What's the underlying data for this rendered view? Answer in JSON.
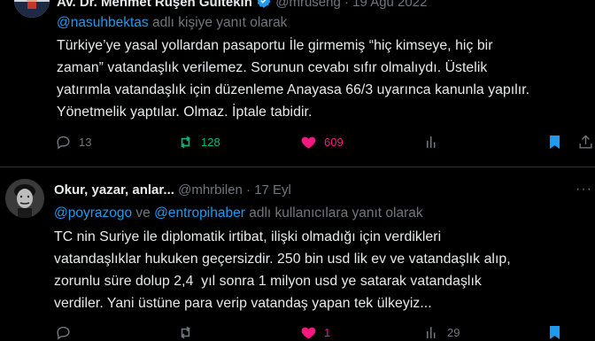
{
  "tweet1": {
    "author_name": "Av. Dr. Mehmet Ruşen Gültekin",
    "handle": "@mruseng",
    "date": "19 Ağu 2022",
    "reply_prefix": "",
    "reply_mentions": [
      "@nasuhbektas"
    ],
    "reply_suffix": " adlı kişiye yanıt olarak",
    "body_lines": [
      "Türkiye’ye yasal yollardan pasaportu İle girmemiş “hiç kimseye, hiç bir",
      "zaman” vatandaşlık verilemez. Sorunun cevabı sıfır olmalıydı. Üstelik",
      "yatırımla vatandaşlık için düzenleme Anayasa 66/3 uyarınca kanunla yapılır.",
      "Yönetmelik yaptılar. Olmaz. İptale tabidir."
    ],
    "replies": "13",
    "retweets": "128",
    "likes": "609"
  },
  "tweet2": {
    "author_name": "Okur, yazar, anlar...",
    "handle": "@mhrbilen",
    "date": "17 Eyl",
    "reply_mentions": [
      "@poyrazogo",
      "@entropihaber"
    ],
    "reply_joiner": " ve ",
    "reply_suffix": " adlı kullanıcılara yanıt olarak",
    "body_lines": [
      "TC nin Suriye ile diplomatik irtibat, ilişki olmadığı için verdikleri",
      "vatandaşlıklar hukuken geçersizdir. 250 bin usd lik ev ve vatandaşlık alıp,",
      "zorunlu süre dolup 2,4  yıl sonra 1 milyon usd ye satarak vatandaşlık",
      "verdiler. Yani üstüne para verip vatandaş yapan tek ülkeyiz..."
    ],
    "likes": "1",
    "views": "29"
  },
  "separator": "·",
  "more_glyph": "···",
  "colors": {
    "background": "#000000",
    "text": "#e7e9ea",
    "muted": "#71767b",
    "link": "#1d9bf0",
    "retweet": "#00ba7c",
    "like": "#f91880",
    "divider": "#2f3336"
  },
  "icons": [
    "reply-icon",
    "retweet-icon",
    "heart-icon",
    "views-icon",
    "bookmark-icon",
    "share-icon",
    "verified-badge-icon",
    "more-icon"
  ]
}
